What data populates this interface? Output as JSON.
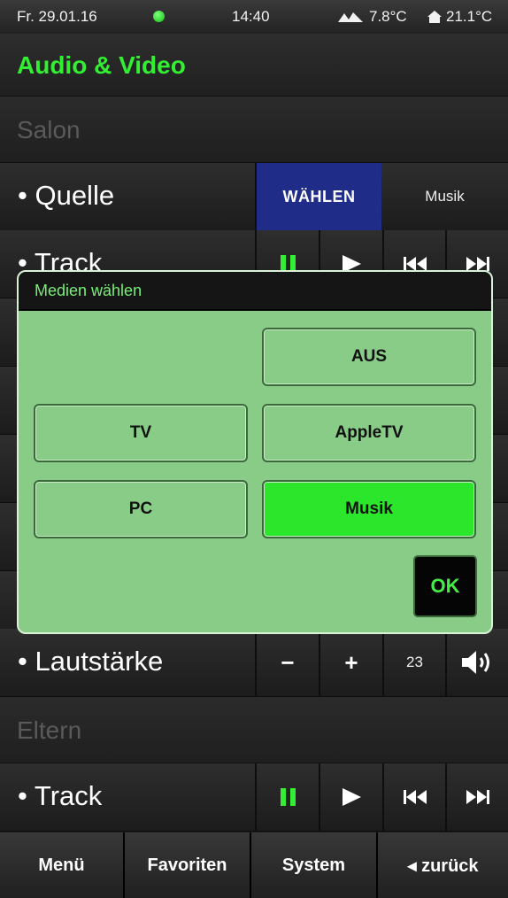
{
  "status": {
    "date": "Fr. 29.01.16",
    "time": "14:40",
    "outdoor_temp": "7.8°C",
    "indoor_temp": "21.1°C"
  },
  "header": {
    "title": "Audio & Video"
  },
  "sections": {
    "salon": "Salon",
    "eltern": "Eltern"
  },
  "rows": {
    "quelle": {
      "label": "• Quelle",
      "button": "WÄHLEN",
      "value": "Musik"
    },
    "track_top": {
      "label": "• Track"
    },
    "lautstaerke": {
      "label": "• Lautstärke",
      "minus": "−",
      "plus": "+",
      "value": "23"
    },
    "track_bottom": {
      "label": "• Track"
    }
  },
  "dialog": {
    "title": "Medien wählen",
    "options": {
      "aus": "AUS",
      "tv": "TV",
      "appletv": "AppleTV",
      "pc": "PC",
      "musik": "Musik"
    },
    "selected": "Musik",
    "ok": "OK"
  },
  "tabbar": {
    "menu": "Menü",
    "favorites": "Favoriten",
    "system": "System",
    "back": "◂ zurück"
  },
  "colors": {
    "accent_green": "#33ee33",
    "select_blue": "#1f2d88",
    "dialog_bg": "#88cc88",
    "selected_option": "#2ce62c"
  },
  "icons": [
    "status-dot-icon",
    "weather-icon",
    "home-icon",
    "pause-icon",
    "play-icon",
    "skip-back-icon",
    "skip-forward-icon",
    "speaker-icon"
  ]
}
